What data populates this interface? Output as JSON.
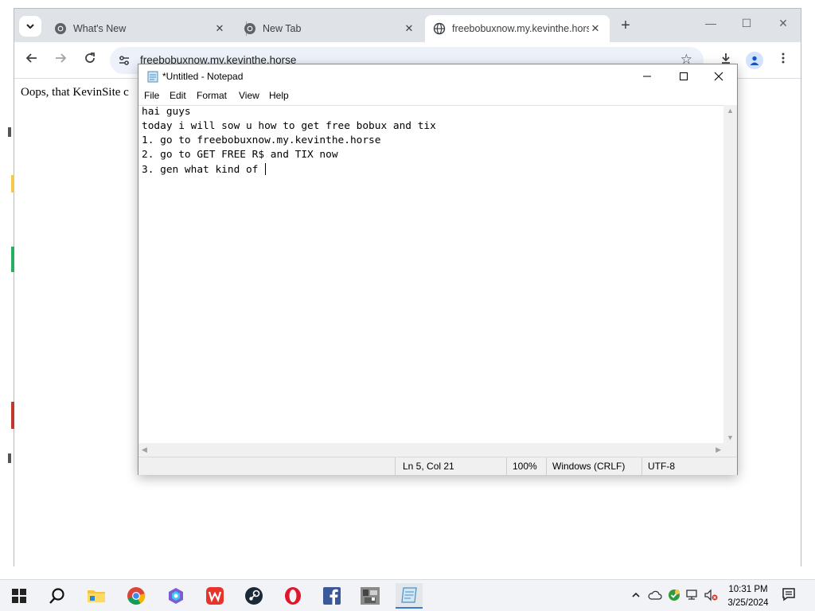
{
  "browser": {
    "tabs": [
      {
        "label": "What's New",
        "close": "✕"
      },
      {
        "label": "New Tab",
        "close": "✕"
      },
      {
        "label": "freebobuxnow.my.kevinthe.horse",
        "close": "✕"
      }
    ],
    "new_tab": "+",
    "window_controls": {
      "minimize": "—",
      "maximize": "☐",
      "close": "✕"
    },
    "url": "freebobuxnow.my.kevinthe.horse",
    "page_text": "Oops, that KevinSite c"
  },
  "notepad": {
    "title": "*Untitled - Notepad",
    "menu": [
      "File",
      "Edit",
      "Format",
      "View",
      "Help"
    ],
    "lines": [
      "hai guys",
      "today i will sow u how to get free bobux and tix",
      "1. go to freebobuxnow.my.kevinthe.horse",
      "2. go to GET FREE R$ and TIX now",
      "3. gen what kind of "
    ],
    "status": {
      "position": "Ln 5, Col 21",
      "zoom": "100%",
      "line_ending": "Windows (CRLF)",
      "encoding": "UTF-8"
    }
  },
  "taskbar": {
    "clock_time": "10:31 PM",
    "clock_date": "3/25/2024"
  },
  "colors": {
    "chrome_tabstrip": "#dfe3e8",
    "omnibox": "#edf2fa",
    "taskbar": "#f1f3f6",
    "accent": "#3b78d8"
  }
}
